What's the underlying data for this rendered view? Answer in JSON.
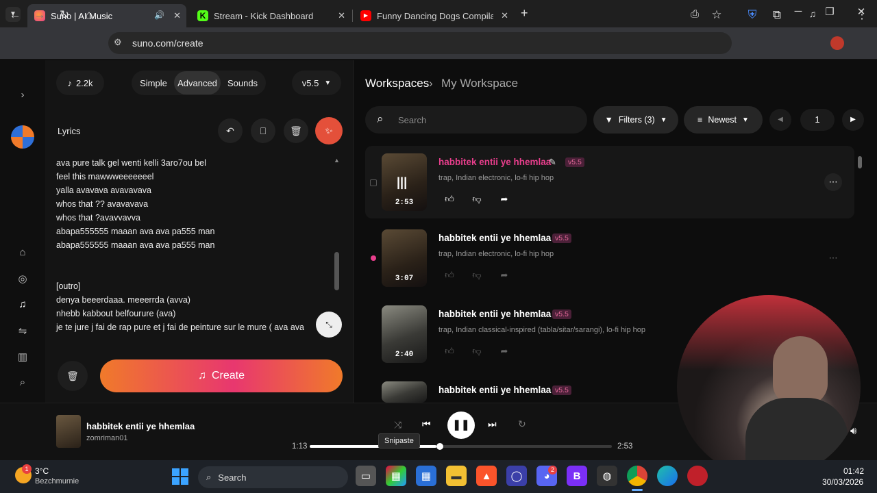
{
  "tabs": [
    {
      "title": "Suno | AI Music",
      "active": true
    },
    {
      "title": "Stream - Kick Dashboard",
      "active": false
    },
    {
      "title": "Funny Dancing Dogs Compilati",
      "active": false
    }
  ],
  "address": {
    "url": "suno.com/create"
  },
  "left": {
    "credits": "2.2k",
    "modes": [
      "Simple",
      "Advanced",
      "Sounds"
    ],
    "active_mode": "Advanced",
    "version": "v5.5",
    "lyrics_label": "Lyrics",
    "lyrics": [
      "ava pure talk gel wenti kelli 3aro7ou bel",
      "feel this mawwweeeeeeel",
      "yalla avavava avavavava",
      "whos that ?? avavavava",
      "whos that ?avavvavva",
      "abapa555555 maaan ava ava pa555 man",
      "abapa555555 maaan ava ava pa555 man",
      "",
      "",
      "[outro]",
      "denya beeerdaaa. meeerrda (avva)",
      "nhebb kabbout belfourure (ava)",
      "je te jure j fai  de rap pure et j fai de peinture  sur le mure ( ava ava"
    ],
    "create_label": "Create"
  },
  "workspace": {
    "crumb_root": "Workspaces",
    "crumb_current": "My Workspace",
    "search_placeholder": "Search",
    "filters_label": "Filters (3)",
    "sort_label": "Newest",
    "page": "1",
    "songs": [
      {
        "title": "habbitek entii ye hhemlaa",
        "version": "v5.5",
        "tags": "trap, Indian electronic, lo-fi hip hop",
        "duration": "2:53"
      },
      {
        "title": "habbitek entii ye hhemlaa",
        "version": "v5.5",
        "tags": "trap, Indian electronic, lo-fi hip hop",
        "duration": "3:07"
      },
      {
        "title": "habbitek entii ye hhemlaa",
        "version": "v5.5",
        "tags": "trap, Indian classical-inspired (tabla/sitar/sarangi), lo-fi hip hop",
        "duration": "2:40"
      },
      {
        "title": "habbitek entii ye hhemlaa",
        "version": "v5.5",
        "tags": "",
        "duration": ""
      }
    ]
  },
  "player": {
    "title": "habbitek entii ye hhemlaa",
    "artist": "zomriman01",
    "elapsed": "1:13",
    "total": "2:53",
    "progress": 0.42,
    "tooltip": "Snipaste"
  },
  "taskbar": {
    "weather_temp": "3°C",
    "weather_place": "Bezchmurnie",
    "weather_badge": "1",
    "search_label": "Search",
    "discord_badge": "2",
    "time": "01:42",
    "date": "30/03/2026"
  },
  "colors": {
    "accent_pink": "#e83e8c",
    "create_start": "#f07a2a",
    "create_end": "#e8376f"
  }
}
